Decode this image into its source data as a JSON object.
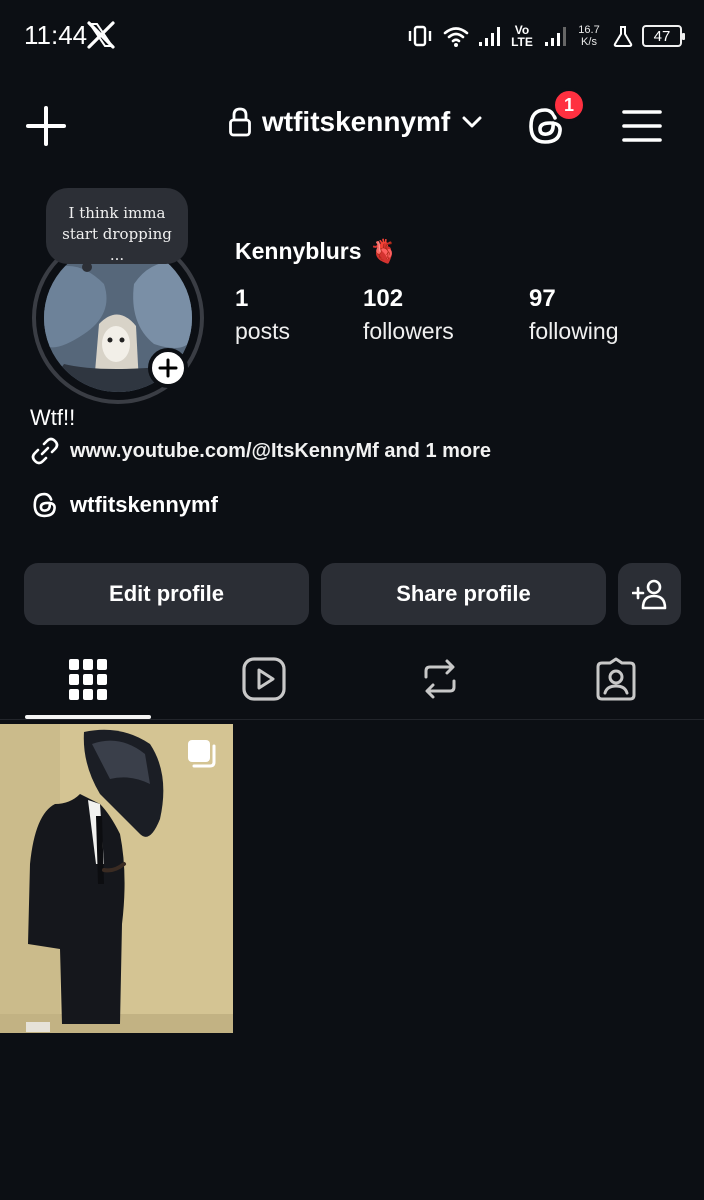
{
  "status_bar": {
    "time": "11:44",
    "network_label_top": "Vo",
    "network_label_bottom": "LTE",
    "speed_value": "16.7",
    "speed_unit": "K/s",
    "battery": "47"
  },
  "header": {
    "username": "wtfitskennymf",
    "notification_count": "1"
  },
  "profile": {
    "note_text": "I think imma start dropping ...",
    "display_name": "Kennyblurs",
    "name_emoji": "🫀",
    "stats": [
      {
        "value": "1",
        "label": "posts"
      },
      {
        "value": "102",
        "label": "followers"
      },
      {
        "value": "97",
        "label": "following"
      }
    ],
    "bio": "Wtf!!",
    "link": "www.youtube.com/@ItsKennyMf and 1 more",
    "threads_handle": "wtfitskennymf"
  },
  "actions": {
    "edit_label": "Edit profile",
    "share_label": "Share profile"
  },
  "tabs": [
    {
      "icon": "grid-icon",
      "active": true
    },
    {
      "icon": "reels-icon",
      "active": false
    },
    {
      "icon": "reposts-icon",
      "active": false
    },
    {
      "icon": "tagged-icon",
      "active": false
    }
  ],
  "colors": {
    "background": "#0c0f14",
    "button_bg": "#2b2e35",
    "badge_red": "#ff3040"
  }
}
